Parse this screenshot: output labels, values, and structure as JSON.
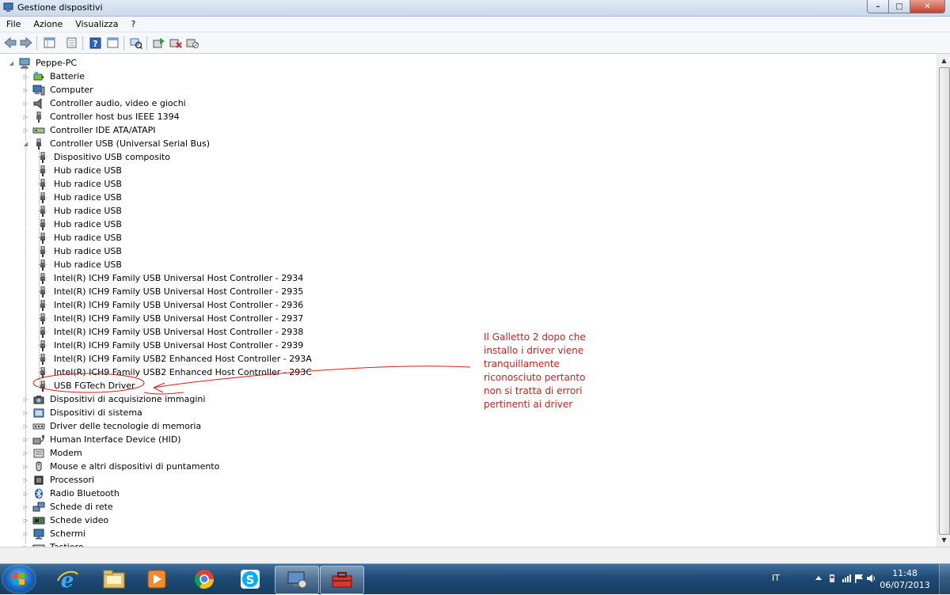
{
  "window": {
    "title": "Gestione dispositivi",
    "buttons": {
      "minimize": "–",
      "maximize": "□",
      "close": "✕"
    }
  },
  "menu": [
    "File",
    "Azione",
    "Visualizza",
    "?"
  ],
  "toolbar": {
    "icons": [
      "back-icon",
      "forward-icon",
      "view-icon",
      "properties-icon",
      "help-icon",
      "view-alt-icon",
      "scan-icon",
      "update-driver-icon",
      "uninstall-icon",
      "disable-icon"
    ]
  },
  "tree": {
    "root": "Peppe-PC",
    "categories_before": [
      {
        "label": "Batterie",
        "icon": "battery-icon"
      },
      {
        "label": "Computer",
        "icon": "computer-icon"
      },
      {
        "label": "Controller audio, video e giochi",
        "icon": "speaker-icon"
      },
      {
        "label": "Controller host bus IEEE 1394",
        "icon": "firewire-icon"
      },
      {
        "label": "Controller IDE ATA/ATAPI",
        "icon": "ide-icon"
      }
    ],
    "usb_category": "Controller USB (Universal Serial Bus)",
    "usb_children": [
      "Dispositivo USB composito",
      "Hub radice USB",
      "Hub radice USB",
      "Hub radice USB",
      "Hub radice USB",
      "Hub radice USB",
      "Hub radice USB",
      "Hub radice USB",
      "Hub radice USB",
      "Intel(R) ICH9 Family USB Universal Host Controller - 2934",
      "Intel(R) ICH9 Family USB Universal Host Controller - 2935",
      "Intel(R) ICH9 Family USB Universal Host Controller - 2936",
      "Intel(R) ICH9 Family USB Universal Host Controller - 2937",
      "Intel(R) ICH9 Family USB Universal Host Controller - 2938",
      "Intel(R) ICH9 Family USB Universal Host Controller - 2939",
      "Intel(R) ICH9 Family USB2 Enhanced Host Controller - 293A",
      "Intel(R) ICH9 Family USB2 Enhanced Host Controller - 293C",
      "USB FGTech Driver"
    ],
    "categories_after": [
      {
        "label": "Dispositivi di acquisizione immagini",
        "icon": "camera-icon"
      },
      {
        "label": "Dispositivi di sistema",
        "icon": "system-device-icon"
      },
      {
        "label": "Driver delle tecnologie di memoria",
        "icon": "memory-icon"
      },
      {
        "label": "Human Interface Device (HID)",
        "icon": "hid-icon"
      },
      {
        "label": "Modem",
        "icon": "modem-icon"
      },
      {
        "label": "Mouse e altri dispositivi di puntamento",
        "icon": "mouse-icon"
      },
      {
        "label": "Processori",
        "icon": "processor-icon"
      },
      {
        "label": "Radio Bluetooth",
        "icon": "bluetooth-icon"
      },
      {
        "label": "Schede di rete",
        "icon": "network-icon"
      },
      {
        "label": "Schede video",
        "icon": "display-adapter-icon"
      },
      {
        "label": "Schermi",
        "icon": "monitor-icon"
      },
      {
        "label": "Tastiere",
        "icon": "keyboard-icon"
      }
    ]
  },
  "annotation": {
    "text": "Il Galletto 2 dopo che installo i driver viene tranquillamente riconosciuto pertanto non si tratta di errori pertinenti ai driver",
    "color": "#c8221b"
  },
  "taskbar": {
    "apps": [
      "internet-explorer-icon",
      "explorer-folder-icon",
      "media-player-icon",
      "chrome-icon",
      "skype-icon",
      "device-manager-icon",
      "toolbox-icon"
    ],
    "language": "IT",
    "time": "11:48",
    "date": "06/07/2013"
  }
}
